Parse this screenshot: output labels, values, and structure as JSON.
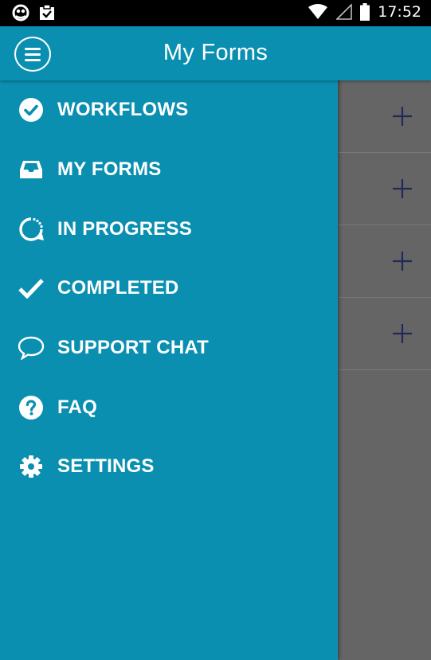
{
  "status_bar": {
    "time": "17:52"
  },
  "appbar": {
    "title": "My Forms"
  },
  "nav": {
    "items": [
      {
        "label": "WORKFLOWS",
        "icon": "check-circle-icon"
      },
      {
        "label": "MY FORMS",
        "icon": "inbox-icon"
      },
      {
        "label": "IN PROGRESS",
        "icon": "progress-icon"
      },
      {
        "label": "COMPLETED",
        "icon": "checkmark-icon"
      },
      {
        "label": "SUPPORT CHAT",
        "icon": "chat-bubble-icon"
      },
      {
        "label": "FAQ",
        "icon": "question-circle-icon"
      },
      {
        "label": "SETTINGS",
        "icon": "gear-icon"
      }
    ]
  },
  "colors": {
    "primary": "#0a8fb1",
    "overlay": "#656565",
    "plus": "#1f2a5a"
  }
}
